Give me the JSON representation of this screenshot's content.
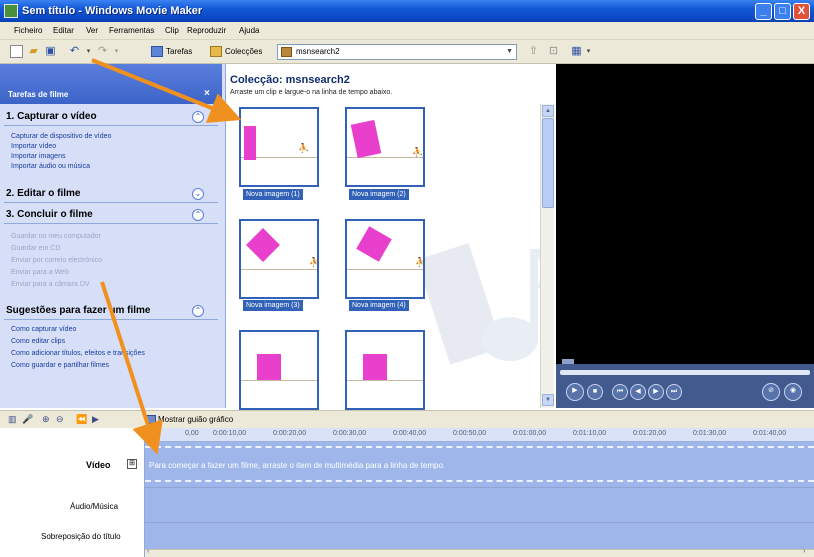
{
  "window": {
    "title": "Sem título - Windows Movie Maker",
    "minimize": "_",
    "maximize": "□",
    "close": "X"
  },
  "menu": [
    "Ficheiro",
    "Editar",
    "Ver",
    "Ferramentas",
    "Clip",
    "Reproduzir",
    "Ajuda"
  ],
  "toolbar": {
    "tasks_label": "Tarefas",
    "collections_label": "Colecções",
    "collection_selected": "msnsearch2"
  },
  "taskpane": {
    "header": "Tarefas de filme",
    "close": "×",
    "sections": [
      {
        "title": "1. Capturar o vídeo",
        "toggle": "⌃",
        "links": [
          {
            "label": "Capturar de dispositivo de vídeo",
            "enabled": true
          },
          {
            "label": "Importar vídeo",
            "enabled": true
          },
          {
            "label": "Importar imagens",
            "enabled": true
          },
          {
            "label": "Importar áudio ou música",
            "enabled": true
          }
        ]
      },
      {
        "title": "2. Editar o filme",
        "toggle": "⌄",
        "links": []
      },
      {
        "title": "3. Concluir o filme",
        "toggle": "⌃",
        "links": [
          {
            "label": "Guardar no meu computador",
            "enabled": false
          },
          {
            "label": "Guardar em CD",
            "enabled": false
          },
          {
            "label": "Enviar por correio electrónico",
            "enabled": false
          },
          {
            "label": "Enviar para a Web",
            "enabled": false
          },
          {
            "label": "Enviar para a câmara DV",
            "enabled": false
          }
        ]
      },
      {
        "title": "Sugestões para fazer um filme",
        "toggle": "⌃",
        "links": [
          {
            "label": "Como capturar vídeo",
            "enabled": true
          },
          {
            "label": "Como editar clips",
            "enabled": true
          },
          {
            "label": "Como adicionar títulos, efeitos e transições",
            "enabled": true
          },
          {
            "label": "Como guardar e partilhar filmes",
            "enabled": true
          }
        ]
      }
    ]
  },
  "collection": {
    "title": "Colecção: msnsearch2",
    "subtitle": "Arraste um clip e largue-o na linha de tempo abaixo.",
    "clips": [
      {
        "label": "Nova imagem (1)"
      },
      {
        "label": "Nova imagem (2)"
      },
      {
        "label": "Nova imagem (3)"
      },
      {
        "label": "Nova imagem (4)"
      },
      {
        "label": ""
      },
      {
        "label": ""
      }
    ]
  },
  "timeline": {
    "show_storyboard_label": "Mostrar guião gráfico",
    "ruler_ticks": [
      "0,00",
      "0:00:10,00",
      "0:00:20,00",
      "0:00:30,00",
      "0:00:40,00",
      "0:00:50,00",
      "0:01:00,00",
      "0:01:10,00",
      "0:01:20,00",
      "0:01:30,00",
      "0:01:40,00"
    ],
    "tracks": {
      "video": "Vídeo",
      "video_toggle": "⊞",
      "audio": "Áudio/Música",
      "title": "Sobreposição do título"
    },
    "hint": "Para começar a fazer um filme, arraste o item de multimédia para a linha de tempo."
  },
  "colors": {
    "annotation_arrow": "#f0901e",
    "titlebar": "#0a46c2",
    "task_pane": "#d6dff7",
    "timeline_track": "#9eb6ea",
    "clip_shape": "#e83fcc"
  }
}
